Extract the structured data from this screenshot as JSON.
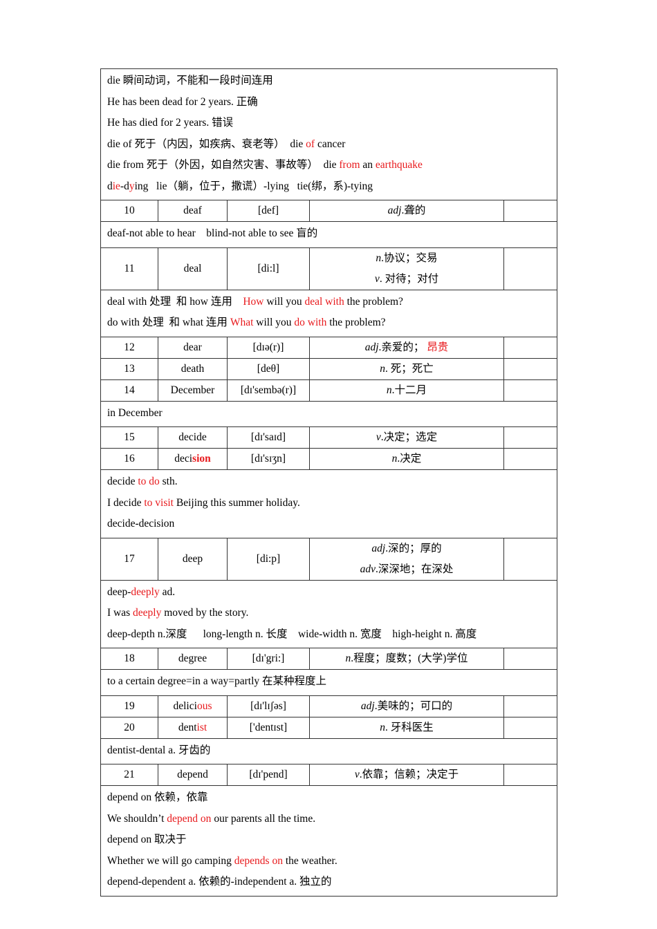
{
  "colors": {
    "highlight": "#e8191c",
    "text": "#000000",
    "border": "#333333"
  },
  "table": {
    "rows": [
      {
        "type": "note",
        "lines": [
          [
            {
              "t": "die 瞬间动词，不能和一段时间连用"
            }
          ],
          [
            {
              "t": "He has been dead for 2 years. 正确"
            }
          ],
          [
            {
              "t": "He has died for 2 years. 错误"
            }
          ],
          [
            {
              "t": "die of 死于（内因，如疾病、衰老等）  die "
            },
            {
              "t": "of",
              "red": true
            },
            {
              "t": " cancer"
            }
          ],
          [
            {
              "t": "die from 死于（外因，如自然灾害、事故等）  die "
            },
            {
              "t": "from",
              "red": true
            },
            {
              "t": " an "
            },
            {
              "t": "earthquake",
              "red": true
            }
          ],
          [
            {
              "t": "d"
            },
            {
              "t": "ie",
              "red": true
            },
            {
              "t": "-d"
            },
            {
              "t": "y",
              "red": true
            },
            {
              "t": "ing   lie（躺，位于，撒谎）-lying   tie(绑，系)-tying"
            }
          ]
        ]
      },
      {
        "type": "word",
        "num": "10",
        "word": [
          {
            "t": "deaf"
          }
        ],
        "phonetic": "[def]",
        "meanings": [
          [
            {
              "t": "adj",
              "it": true
            },
            {
              "t": ".聋的"
            }
          ]
        ]
      },
      {
        "type": "note",
        "lines": [
          [
            {
              "t": "deaf-not able to hear    blind-not able to see 盲的"
            }
          ]
        ]
      },
      {
        "type": "word",
        "num": "11",
        "word": [
          {
            "t": "deal"
          }
        ],
        "phonetic": "[di:l]",
        "meanings": [
          [
            {
              "t": "n",
              "it": true
            },
            {
              "t": ".协议；交易"
            }
          ],
          [
            {
              "t": "v",
              "it": true
            },
            {
              "t": ". 对待；对付"
            }
          ]
        ]
      },
      {
        "type": "note",
        "lines": [
          [
            {
              "t": "deal with 处理  和 how 连用    "
            },
            {
              "t": "How",
              "red": true
            },
            {
              "t": " will you "
            },
            {
              "t": "deal with",
              "red": true
            },
            {
              "t": " the problem?"
            }
          ],
          [
            {
              "t": "do with 处理  和 what 连用 "
            },
            {
              "t": "What",
              "red": true
            },
            {
              "t": " will you "
            },
            {
              "t": "do with",
              "red": true
            },
            {
              "t": " the problem?"
            }
          ]
        ]
      },
      {
        "type": "word",
        "num": "12",
        "word": [
          {
            "t": "dear"
          }
        ],
        "phonetic": "[dɪə(r)]",
        "meanings": [
          [
            {
              "t": "adj",
              "it": true
            },
            {
              "t": ".亲爱的；  "
            },
            {
              "t": "昂贵",
              "red": true
            }
          ]
        ]
      },
      {
        "type": "word",
        "num": "13",
        "word": [
          {
            "t": "death"
          }
        ],
        "phonetic": "[deθ]",
        "meanings": [
          [
            {
              "t": "n",
              "it": true
            },
            {
              "t": ". 死；死亡"
            }
          ]
        ]
      },
      {
        "type": "word",
        "num": "14",
        "word": [
          {
            "t": "December"
          }
        ],
        "phonetic": "[dɪ'sembə(r)]",
        "meanings": [
          [
            {
              "t": "n",
              "it": true
            },
            {
              "t": ".十二月"
            }
          ]
        ]
      },
      {
        "type": "note",
        "lines": [
          [
            {
              "t": "in December"
            }
          ]
        ]
      },
      {
        "type": "word",
        "num": "15",
        "word": [
          {
            "t": "decide"
          }
        ],
        "phonetic": "[dɪ'saɪd]",
        "meanings": [
          [
            {
              "t": "v",
              "it": true
            },
            {
              "t": ".决定；选定"
            }
          ]
        ]
      },
      {
        "type": "word",
        "num": "16",
        "word": [
          {
            "t": "deci"
          },
          {
            "t": "sion",
            "red": true,
            "bold": true
          }
        ],
        "phonetic": "[dɪ'sɪʒn]",
        "meanings": [
          [
            {
              "t": "n",
              "it": true
            },
            {
              "t": ".决定"
            }
          ]
        ]
      },
      {
        "type": "note",
        "lines": [
          [
            {
              "t": "decide "
            },
            {
              "t": "to do",
              "red": true
            },
            {
              "t": " sth."
            }
          ],
          [
            {
              "t": "I decide "
            },
            {
              "t": "to visit",
              "red": true
            },
            {
              "t": " Beijing this summer holiday."
            }
          ],
          [
            {
              "t": "decide-decision"
            }
          ]
        ]
      },
      {
        "type": "word",
        "num": "17",
        "word": [
          {
            "t": "deep"
          }
        ],
        "phonetic": "[di:p]",
        "meanings": [
          [
            {
              "t": "adj",
              "it": true
            },
            {
              "t": ".深的；厚的"
            }
          ],
          [
            {
              "t": "adv",
              "it": true
            },
            {
              "t": ".深深地；在深处"
            }
          ]
        ]
      },
      {
        "type": "note",
        "lines": [
          [
            {
              "t": "deep-"
            },
            {
              "t": "deeply",
              "red": true
            },
            {
              "t": " ad."
            }
          ],
          [
            {
              "t": "I was "
            },
            {
              "t": "deeply",
              "red": true
            },
            {
              "t": " moved by the story."
            }
          ],
          [
            {
              "t": "deep-depth n.深度      long-length n. 长度    wide-width n. 宽度    high-height n. 高度"
            }
          ]
        ]
      },
      {
        "type": "word",
        "num": "18",
        "word": [
          {
            "t": "degree"
          }
        ],
        "phonetic": "[dɪ'gri:]",
        "meanings": [
          [
            {
              "t": "n",
              "it": true
            },
            {
              "t": ".程度；度数；(大学)学位"
            }
          ]
        ]
      },
      {
        "type": "note",
        "lines": [
          [
            {
              "t": "to a certain degree=in a way=partly 在某种程度上"
            }
          ]
        ]
      },
      {
        "type": "word",
        "num": "19",
        "word": [
          {
            "t": "delici"
          },
          {
            "t": "ous",
            "red": true
          }
        ],
        "phonetic": "[dɪ'lɪʃəs]",
        "meanings": [
          [
            {
              "t": "adj",
              "it": true
            },
            {
              "t": ".美味的；可口的"
            }
          ]
        ]
      },
      {
        "type": "word",
        "num": "20",
        "word": [
          {
            "t": "dent"
          },
          {
            "t": "ist",
            "red": true
          }
        ],
        "phonetic": "['dentɪst]",
        "meanings": [
          [
            {
              "t": "n",
              "it": true
            },
            {
              "t": ". 牙科医生"
            }
          ]
        ]
      },
      {
        "type": "note",
        "lines": [
          [
            {
              "t": "dentist-dental a. 牙齿的"
            }
          ]
        ]
      },
      {
        "type": "word",
        "num": "21",
        "word": [
          {
            "t": "depend"
          }
        ],
        "phonetic": "[dɪ'pend]",
        "meanings": [
          [
            {
              "t": "v",
              "it": true
            },
            {
              "t": ".依靠；信赖；决定于"
            }
          ]
        ]
      },
      {
        "type": "note",
        "lines": [
          [
            {
              "t": "depend on 依赖，依靠"
            }
          ],
          [
            {
              "t": "We shouldn’t "
            },
            {
              "t": "depend on",
              "red": true
            },
            {
              "t": " our parents all the time."
            }
          ],
          [
            {
              "t": "depend on 取决于"
            }
          ],
          [
            {
              "t": "Whether we will go camping "
            },
            {
              "t": "depends on",
              "red": true
            },
            {
              "t": " the weather."
            }
          ],
          [
            {
              "t": "depend-dependent a. 依赖的-independent a. 独立的"
            }
          ]
        ]
      }
    ]
  }
}
